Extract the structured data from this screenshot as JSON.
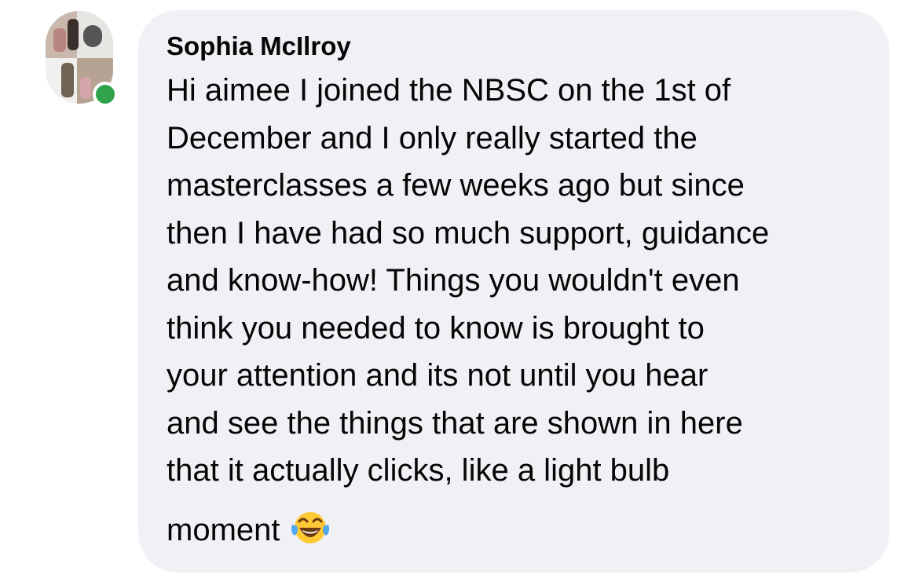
{
  "comment": {
    "author": "Sophia McIlroy",
    "online": true,
    "lines": [
      "Hi aimee I joined the NBSC on the 1st of",
      "December and I only really started the",
      "masterclasses a few weeks ago but since",
      "then I have had so much support, guidance",
      "and know-how! Things you wouldn't even",
      "think you needed to know is brought to",
      "your attention and its not until you hear",
      "and see the things that are shown in here",
      "that it actually clicks, like a light bulb",
      "moment"
    ],
    "trailing_emoji": "face-with-tears-of-joy-icon"
  },
  "colors": {
    "bubble": "#f0f1f5",
    "text": "#050505",
    "presence": "#31a24c"
  }
}
